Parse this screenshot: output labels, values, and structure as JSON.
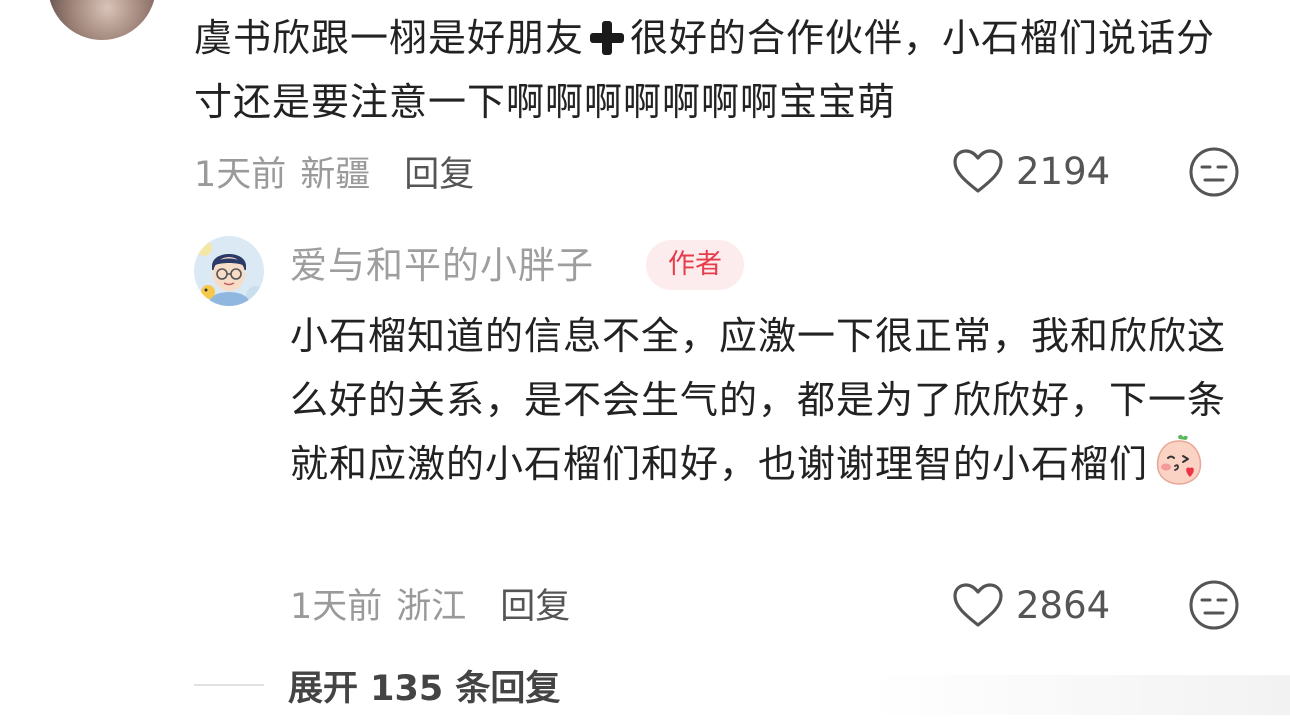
{
  "comment": {
    "text_part1": "虞书欣跟一栩是好朋友",
    "text_part2": "很好的合作伙伴，小石榴们说话分寸还是要注意一下啊啊啊啊啊啊啊宝宝萌",
    "time": "1天前",
    "location": "新疆",
    "reply_label": "回复",
    "like_count": "2194"
  },
  "reply": {
    "author": "爱与和平的小胖子",
    "badge": "作者",
    "text": "小石榴知道的信息不全，应激一下很正常，我和欣欣这么好的关系，是不会生气的，都是为了欣欣好，下一条就和应激的小石榴们和好，也谢谢理智的小石榴们",
    "time": "1天前",
    "location": "浙江",
    "reply_label": "回复",
    "like_count": "2864"
  },
  "expand": {
    "label": "展开 135 条回复"
  },
  "icons": {
    "like": "heart-outline-icon",
    "dislike": "neutral-face-icon",
    "plus": "plus-emoji-icon",
    "sticker": "peach-kiss-emoji-icon"
  },
  "colors": {
    "badge_text": "#e63c4b",
    "badge_bg": "#fdeced",
    "meta_gray": "#9a9a9a"
  }
}
